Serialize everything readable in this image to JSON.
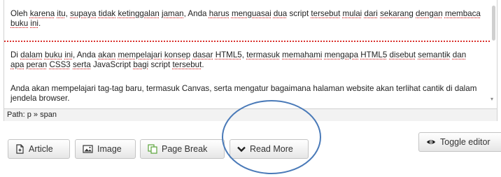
{
  "editor": {
    "paragraph1": {
      "t1": "Oleh ",
      "w1": "karena",
      "t2": " ",
      "w2": "itu",
      "t3": ", ",
      "w3": "supaya",
      "t4": " ",
      "w4": "tidak",
      "t5": " ",
      "w5": "ketinggalan",
      "t6": " ",
      "w6": "jaman",
      "t7": ", Anda ",
      "w7": "harus",
      "t8": " ",
      "w8": "menguasai",
      "t9": " ",
      "w9": "dua",
      "t10": " script ",
      "w10": "tersebut",
      "t11": " ",
      "w11": "mulai",
      "t12": " ",
      "w12": "dari",
      "t13": " ",
      "w13": "sekarang",
      "t14": " ",
      "w14": "dengan",
      "t15": " ",
      "w15": "membaca",
      "t16": " ",
      "w16": "buku",
      "t17": " ",
      "w17": "ini",
      "t18": "."
    },
    "paragraph2": {
      "t1": "Di ",
      "w1": "dalam",
      "t2": " ",
      "w2": "buku",
      "t3": " ",
      "w3": "ini",
      "t4": ", Anda ",
      "w4": "akan",
      "t5": " ",
      "w5": "mempelajari",
      "t6": " ",
      "w6": "konsep",
      "t7": " ",
      "w7": "dasar",
      "t8": " ",
      "w8": "HTML5",
      "t9": ", ",
      "w9": "termasuk",
      "t10": " ",
      "w10": "memahami",
      "t11": " ",
      "w11": "mengapa",
      "t12": " ",
      "w12": "HTML5",
      "t13": " ",
      "w13": "disebut",
      "t14": " ",
      "w14": "semantik",
      "t15": " ",
      "w15": "dan",
      "t16": " ",
      "w16": "apa",
      "t17": " ",
      "w17": "peran",
      "t18": " ",
      "w18": "CSS3",
      "t19": " ",
      "w19": "serta",
      "t20": " JavaScript ",
      "w20": "bagi",
      "t21": " script ",
      "w21": "tersebut",
      "t22": "."
    },
    "paragraph3": "Anda akan mempelajari tag-tag baru, termasuk Canvas, serta mengatur bagaimana halaman website akan terlihat cantik di dalam jendela browser."
  },
  "status_bar": {
    "path": "Path: p » span"
  },
  "buttons": {
    "article": "Article",
    "image": "Image",
    "page_break": "Page Break",
    "read_more": "Read More",
    "toggle_editor": "Toggle editor"
  },
  "colors": {
    "readmore_separator": "#d9302c",
    "annotation_circle": "#4a7ab8"
  },
  "icons": {
    "article": "document-add-icon",
    "image": "picture-icon",
    "page_break": "copy-pages-icon",
    "read_more": "chevron-down-icon",
    "toggle_editor": "eye-icon"
  }
}
